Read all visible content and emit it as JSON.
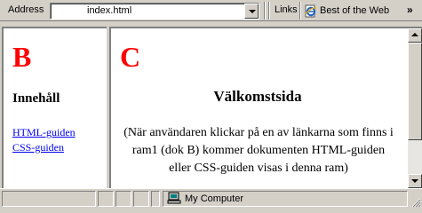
{
  "address_bar": {
    "label": "Address",
    "value": "index.html",
    "links_label": "Links",
    "best_link": "Best of the Web",
    "chevron": "»"
  },
  "frame_b": {
    "letter": "B",
    "heading": "Innehåll",
    "links": [
      "HTML-guiden",
      "CSS-guiden"
    ]
  },
  "frame_c": {
    "letter": "C",
    "title": "Välkomstsida",
    "body": "(När användaren klickar på en av länkarna som finns i ram1 (dok B) kommer dokumenten HTML-guiden eller CSS-guiden visas i denna ram)"
  },
  "status_bar": {
    "zone": "My Computer"
  },
  "icons": {
    "dropdown": "chevron-down-icon",
    "ie": "ie-page-icon",
    "computer": "computer-icon",
    "scroll_up": "arrow-up-icon",
    "scroll_down": "arrow-down-icon"
  },
  "colors": {
    "chrome": "#d4d0c8",
    "frame_letter": "#ff0000",
    "link": "#0000ee"
  }
}
